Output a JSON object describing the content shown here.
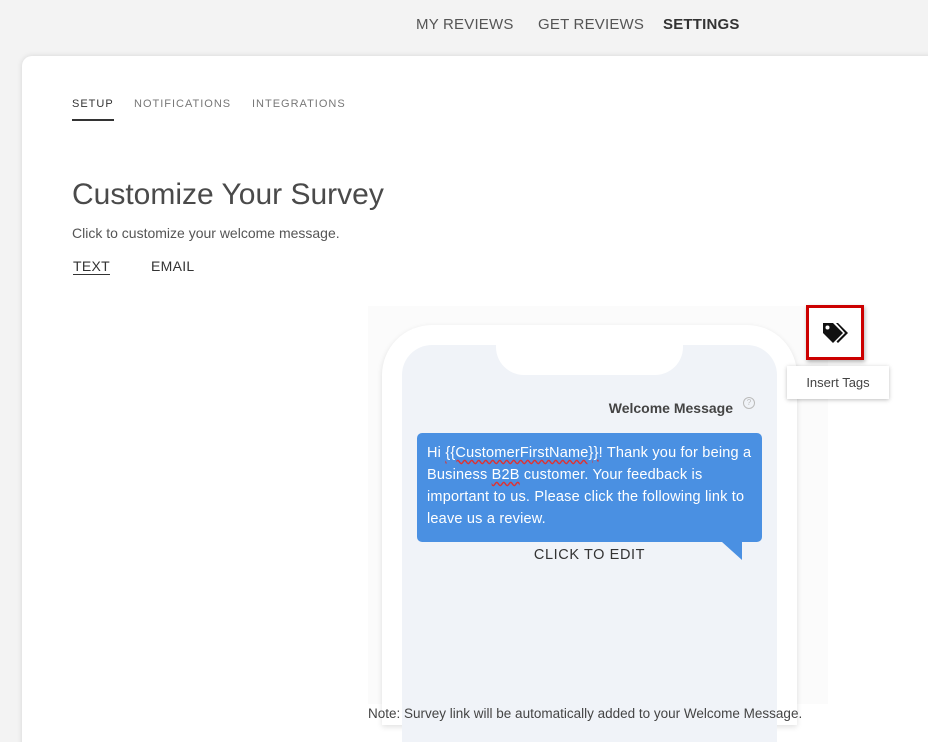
{
  "topnav": {
    "items": [
      {
        "label": "MY REVIEWS",
        "active": false
      },
      {
        "label": "GET REVIEWS",
        "active": false
      },
      {
        "label": "SETTINGS",
        "active": true
      }
    ]
  },
  "settings_tabs": [
    {
      "label": "SETUP",
      "active": true
    },
    {
      "label": "NOTIFICATIONS",
      "active": false
    },
    {
      "label": "INTEGRATIONS",
      "active": false
    }
  ],
  "page": {
    "title": "Customize Your Survey",
    "subtitle": "Click to customize your welcome message."
  },
  "channel_tabs": [
    {
      "label": "TEXT",
      "active": true
    },
    {
      "label": "EMAIL",
      "active": false
    }
  ],
  "phone": {
    "welcome_label": "Welcome Message",
    "help_glyph": "?",
    "message": {
      "prefix": "Hi ",
      "tag_first_name": "{{CustomerFirstName}}",
      "part2": "! Thank you for being a Business ",
      "tag_b2b": "B2B",
      "part3": " customer. Your feedback is important to us. Please click the following link to leave us a review."
    },
    "click_to_edit": "CLICK TO EDIT"
  },
  "note": "Note: Survey link will be automatically added to your Welcome Message.",
  "insert_tags": {
    "tooltip": "Insert Tags",
    "icon": "tags-icon",
    "highlight_color": "#cc0000"
  },
  "colors": {
    "bubble": "#4a90e2",
    "screen": "#f0f3f8"
  }
}
